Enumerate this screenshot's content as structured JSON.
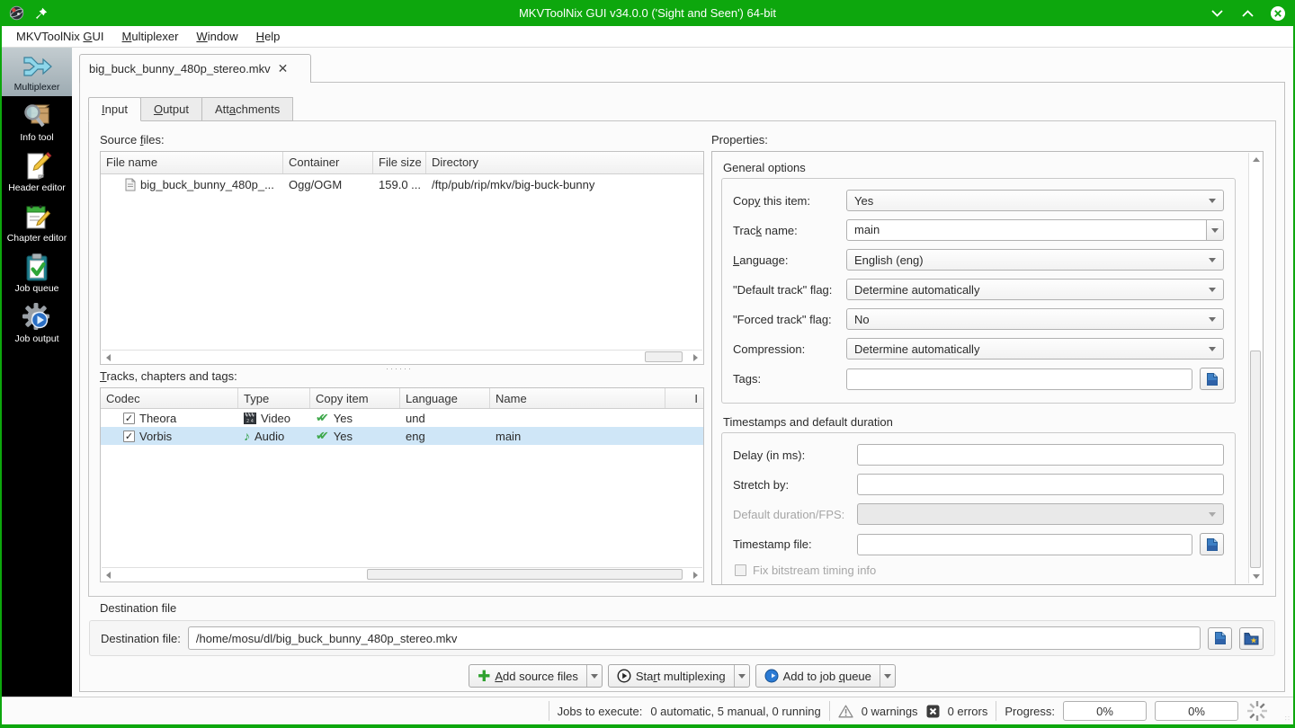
{
  "window": {
    "title": "MKVToolNix GUI v34.0.0 ('Sight and Seen') 64-bit"
  },
  "menubar": {
    "items": [
      "MKVToolNix &GUI",
      "&Multiplexer",
      "&Window",
      "&Help"
    ]
  },
  "sidebar": {
    "items": [
      {
        "label": "Multiplexer",
        "icon": "multiplexer-icon",
        "selected": true
      },
      {
        "label": "Info tool",
        "icon": "info-tool-icon",
        "selected": false
      },
      {
        "label": "Header editor",
        "icon": "header-editor-icon",
        "selected": false
      },
      {
        "label": "Chapter editor",
        "icon": "chapter-editor-icon",
        "selected": false
      },
      {
        "label": "Job queue",
        "icon": "job-queue-icon",
        "selected": false
      },
      {
        "label": "Job output",
        "icon": "job-output-icon",
        "selected": false
      }
    ]
  },
  "document_tab": {
    "label": "big_buck_bunny_480p_stereo.mkv"
  },
  "tabs": {
    "input": "&Input",
    "output": "&Output",
    "attachments": "Att&achments"
  },
  "source_files": {
    "label": "Source &files:",
    "columns": [
      "File name",
      "Container",
      "File size",
      "Directory"
    ],
    "rows": [
      {
        "file_name": "big_buck_bunny_480p_...",
        "container": "Ogg/OGM",
        "file_size": "159.0 ...",
        "directory": "/ftp/pub/rip/mkv/big-buck-bunny"
      }
    ]
  },
  "tracks": {
    "label": "&Tracks, chapters and tags:",
    "columns": [
      "Codec",
      "Type",
      "Copy item",
      "Language",
      "Name",
      "I"
    ],
    "rows": [
      {
        "codec": "Theora",
        "type": "Video",
        "copy": "Yes",
        "language": "und",
        "name": "",
        "checked": true,
        "selected": false
      },
      {
        "codec": "Vorbis",
        "type": "Audio",
        "copy": "Yes",
        "language": "eng",
        "name": "main",
        "checked": true,
        "selected": true
      }
    ]
  },
  "properties": {
    "label": "Properties:",
    "general": {
      "title": "General options",
      "copy_this_item": {
        "label": "Cop&y this item:",
        "value": "Yes"
      },
      "track_name": {
        "label": "Trac&k name:",
        "value": "main"
      },
      "language": {
        "label": "&Language:",
        "value": "English (eng)"
      },
      "default_track_flag": {
        "label": "\"Default track\" flag:",
        "value": "Determine automatically"
      },
      "forced_track_flag": {
        "label": "\"Forced track\" flag:",
        "value": "No"
      },
      "compression": {
        "label": "Compression:",
        "value": "Determine automatically"
      },
      "tags": {
        "label": "Tags:",
        "value": ""
      }
    },
    "timestamps": {
      "title": "Timestamps and default duration",
      "delay": {
        "label": "Delay (in ms):",
        "value": ""
      },
      "stretch_by": {
        "label": "Stretch by:",
        "value": ""
      },
      "default_duration": {
        "label": "Default duration/FPS:",
        "value": "",
        "disabled": true
      },
      "timestamp_file": {
        "label": "Timestamp file:",
        "value": ""
      },
      "fix_bitstream": {
        "label": "Fix bitstream timing info",
        "checked": false,
        "disabled": true
      }
    }
  },
  "destination": {
    "group_label": "Destination file",
    "field_label": "Destination file:",
    "value": "/home/mosu/dl/big_buck_bunny_480p_stereo.mkv"
  },
  "actions": {
    "add_source_files": "&Add source files",
    "start_multiplexing": "Sta&rt multiplexing",
    "add_to_job_queue": "Add to job &queue"
  },
  "statusbar": {
    "jobs_label": "Jobs to execute:",
    "jobs_value": "0 automatic, 5 manual, 0 running",
    "warnings": "0 warnings",
    "errors": "0 errors",
    "progress_label": "Progress:",
    "progress_current": "0%",
    "progress_total": "0%"
  },
  "icons": {
    "close": "✕",
    "checkmark": "✓",
    "check_green": "✔",
    "splitter_dots": "······"
  },
  "colors": {
    "titlebar_green": "#0DA70D",
    "selection_blue": "#cfe6f7",
    "sidebar_black": "#000000",
    "accent_cyan": "#8ed6ea"
  }
}
